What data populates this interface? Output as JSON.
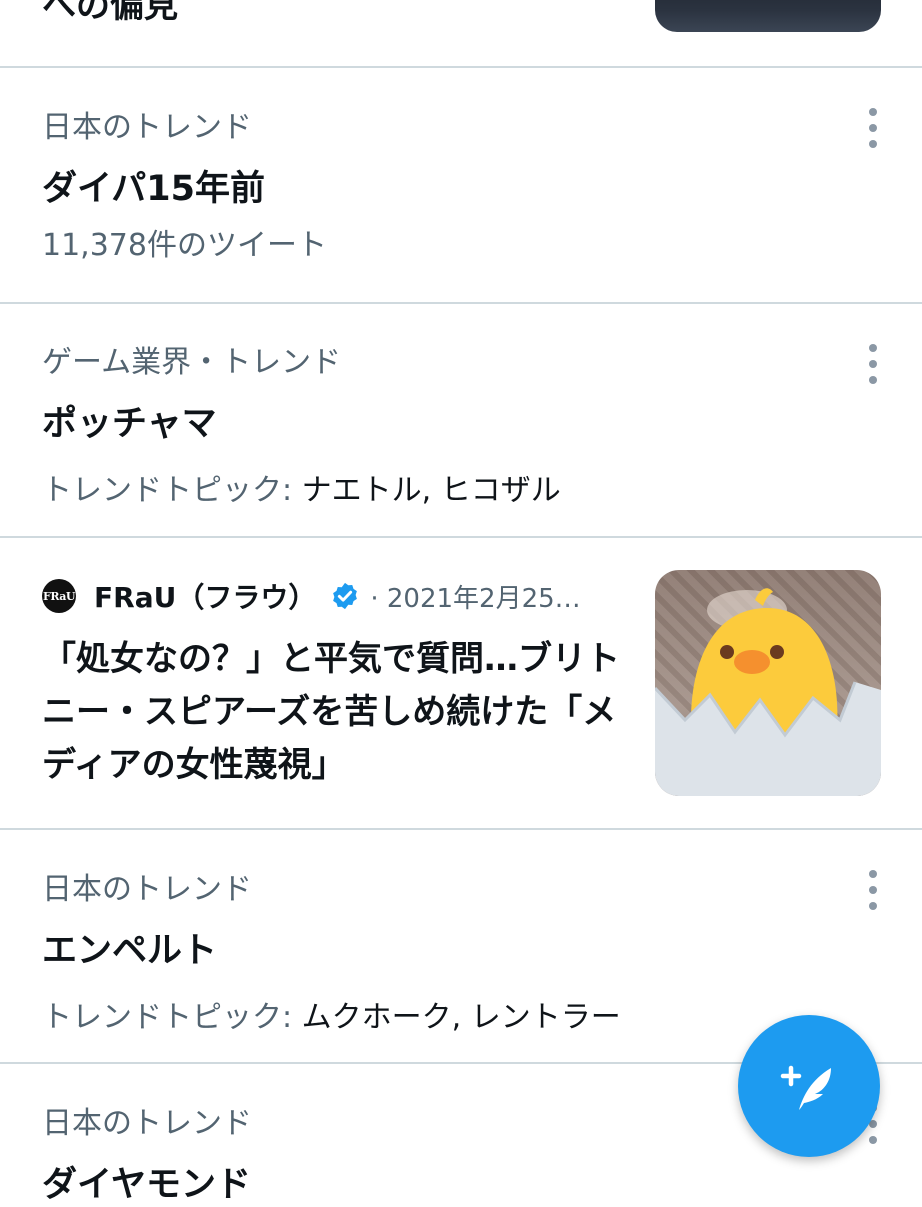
{
  "top_item": {
    "title_fragment": "への偏見"
  },
  "trends": [
    {
      "meta": "日本のトレンド",
      "name": "ダイパ15年前",
      "sub": "11,378件のツイート"
    },
    {
      "meta": "ゲーム業界・トレンド",
      "name": "ポッチャマ",
      "topics_label": "トレンドトピック:",
      "topics": "ナエトル, ヒコザル"
    },
    {
      "meta": "日本のトレンド",
      "name": "エンペルト",
      "topics_label": "トレンドトピック:",
      "topics": "ムクホーク, レントラー"
    },
    {
      "meta": "日本のトレンド",
      "name": "ダイヤモンド"
    }
  ],
  "news": {
    "avatar_text": "FRaU",
    "source": "FRaU（フラウ）",
    "time": "· 2021年2月25…",
    "headline": "「処女なの？」と平気で質問…ブリトニー・スピアーズを苦しめ続けた「メディアの女性蔑視」"
  },
  "icons": {
    "more": "more-vertical-icon",
    "verified": "verified-badge-icon",
    "compose": "compose-tweet-icon"
  },
  "colors": {
    "accent": "#1d9bf0",
    "secondary_text": "#536471",
    "divider": "#cfd9de"
  }
}
